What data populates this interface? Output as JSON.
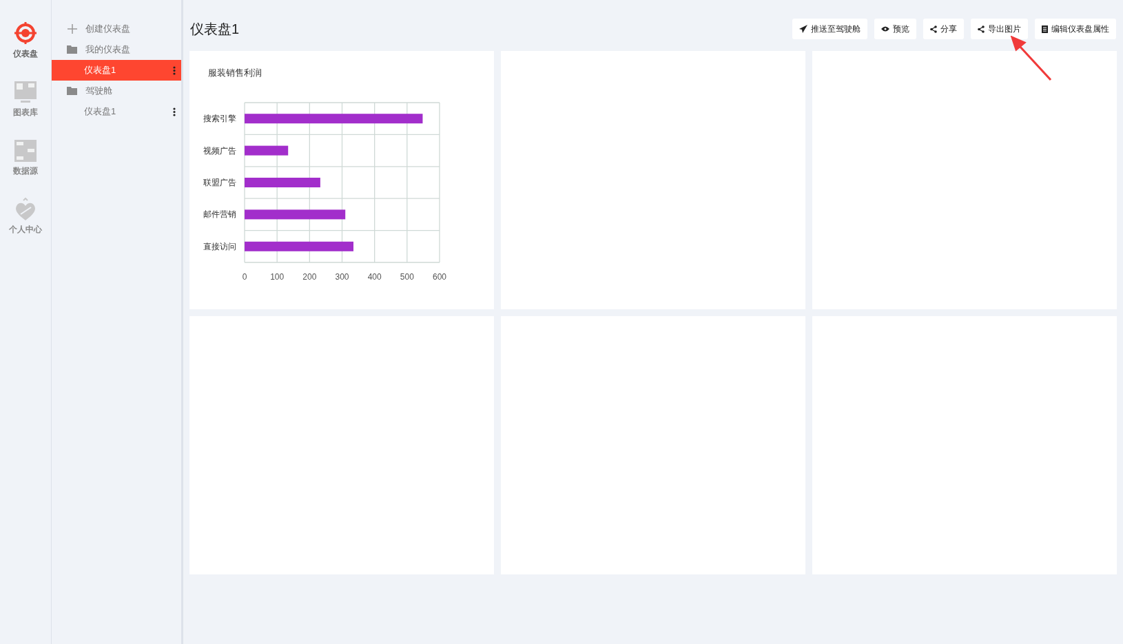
{
  "rail": [
    {
      "label": "仪表盘",
      "kind": "target",
      "selected": true
    },
    {
      "label": "图表库",
      "kind": "monitor",
      "selected": false
    },
    {
      "label": "数据源",
      "kind": "data",
      "selected": false
    },
    {
      "label": "个人中心",
      "kind": "heart",
      "selected": false
    }
  ],
  "tree": [
    {
      "label": "创建仪表盘",
      "kind": "create"
    },
    {
      "label": "我的仪表盘",
      "kind": "folder",
      "children": [
        {
          "label": "仪表盘1",
          "selected": true
        }
      ]
    },
    {
      "label": "驾驶舱",
      "kind": "folder",
      "children": [
        {
          "label": "仪表盘1",
          "selected": false
        }
      ]
    }
  ],
  "page_title": "仪表盘1",
  "toolbar": [
    {
      "label": "推送至驾驶舱",
      "kind": "send"
    },
    {
      "label": "预览",
      "kind": "eye"
    },
    {
      "label": "分享",
      "kind": "share"
    },
    {
      "label": "导出图片",
      "kind": "share"
    },
    {
      "label": "编辑仪表盘属性",
      "kind": "doc"
    }
  ],
  "cards": [
    {
      "kind": "chart",
      "title": "服装销售利润",
      "chart_data": {
        "type": "bar",
        "orientation": "horizontal",
        "grid": true,
        "categories": [
          "搜索引擎",
          "视频广告",
          "联盟广告",
          "邮件营销",
          "直接访问"
        ],
        "series": [
          {
            "color": "#a22ecb",
            "values": [
              548,
              134,
              233,
              310,
              335
            ]
          }
        ],
        "xlim": [
          0,
          600
        ],
        "xticks": [
          0,
          100,
          200,
          300,
          400,
          500,
          600
        ]
      }
    },
    {
      "kind": "empty"
    },
    {
      "kind": "empty"
    },
    {
      "kind": "empty"
    },
    {
      "kind": "empty"
    },
    {
      "kind": "empty"
    }
  ]
}
